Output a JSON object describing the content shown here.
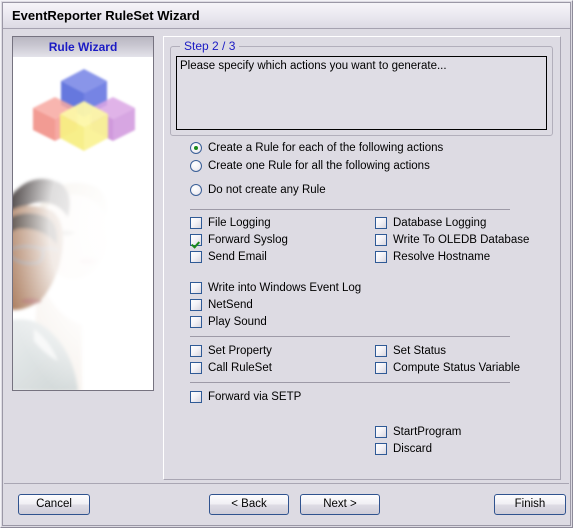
{
  "window": {
    "title": "EventReporter RuleSet Wizard"
  },
  "sidebar": {
    "header_title": "Rule Wizard",
    "logo_icon": "colored-cubes-icon",
    "photo_icon": "people-photo-image"
  },
  "step_group": {
    "legend": "Step 2 / 3",
    "description": "Please specify which actions you want to generate..."
  },
  "rule_mode": {
    "options": [
      {
        "label": "Create a Rule for each of the following actions",
        "checked": true
      },
      {
        "label": "Create one Rule for all the following actions",
        "checked": false
      },
      {
        "label": "Do not create any Rule",
        "checked": false
      }
    ]
  },
  "actions": {
    "group1_left": [
      {
        "label": "File Logging",
        "checked": false
      },
      {
        "label": "Forward Syslog",
        "checked": true
      },
      {
        "label": "Send Email",
        "checked": false
      }
    ],
    "group1_right": [
      {
        "label": "Database Logging",
        "checked": false
      },
      {
        "label": "Write To OLEDB Database",
        "checked": false
      },
      {
        "label": "Resolve Hostname",
        "checked": false
      }
    ],
    "group2_left": [
      {
        "label": "Write into Windows Event Log",
        "checked": false
      },
      {
        "label": "NetSend",
        "checked": false
      },
      {
        "label": "Play Sound",
        "checked": false
      }
    ],
    "group3_left": [
      {
        "label": "Set Property",
        "checked": false
      },
      {
        "label": "Call RuleSet",
        "checked": false
      }
    ],
    "group3_right": [
      {
        "label": "Set Status",
        "checked": false
      },
      {
        "label": "Compute Status Variable",
        "checked": false
      }
    ],
    "group4_left": [
      {
        "label": "Forward via SETP",
        "checked": false
      }
    ],
    "group5_right": [
      {
        "label": "StartProgram",
        "checked": false
      },
      {
        "label": "Discard",
        "checked": false
      }
    ]
  },
  "footer": {
    "cancel_label": "Cancel",
    "back_label": "< Back",
    "next_label": "Next >",
    "finish_label": "Finish"
  },
  "colors": {
    "window_bg": "#dddbe3",
    "accent_blue": "#1b1bc4",
    "check_green": "#1a8a1a",
    "control_border": "#2f5a96"
  }
}
